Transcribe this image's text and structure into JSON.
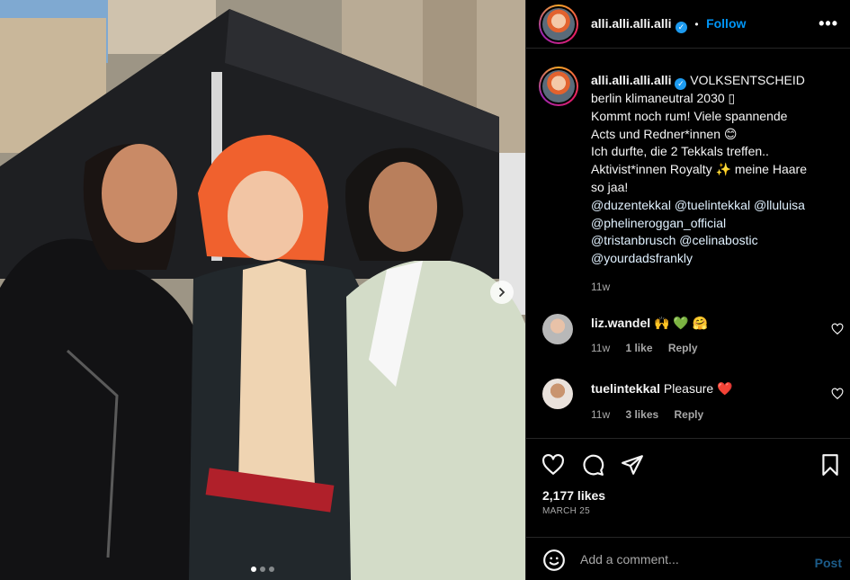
{
  "post": {
    "username": "alli.alli.alli.alli",
    "verified_mark": "✓",
    "follow_label": "Follow",
    "separator": "•",
    "more_label": "•••",
    "caption_lines": [
      "VOLKSENTSCHEID",
      "berlin klimaneutral 2030 ▯",
      "Kommt noch rum! Viele spannende",
      "Acts und Redner*innen 😊",
      "Ich durfte, die 2 Tekkals treffen..",
      "Aktivist*innen Royalty ✨ meine Haare",
      "so jaa!"
    ],
    "tags_lines": [
      "@duzentekkal @tuelintekkal @lluluisa",
      "@phelineroggan_official",
      "@tristanbrusch @celinabostic",
      "@yourdadsfrankly"
    ],
    "caption_time": "11w",
    "likes": "2,177 likes",
    "date": "MARCH 25",
    "photo_position": 1,
    "photo_count": 3
  },
  "comments": [
    {
      "user": "liz.wandel",
      "text": "🙌 💚 🤗",
      "time": "11w",
      "likes": "1 like",
      "reply": "Reply"
    },
    {
      "user": "tuelintekkal",
      "text": "Pleasure ❤️",
      "time": "11w",
      "likes": "3 likes",
      "reply": "Reply"
    }
  ],
  "composer": {
    "placeholder": "Add a comment...",
    "post_label": "Post"
  },
  "icons": [
    "heart-icon",
    "comment-icon",
    "share-icon",
    "bookmark-icon",
    "emoji-icon",
    "chevron-right-icon",
    "more-icon"
  ],
  "colors": {
    "accent": "#0095f6",
    "muted": "#a8a8a8",
    "background": "#000000",
    "divider": "#262626"
  }
}
